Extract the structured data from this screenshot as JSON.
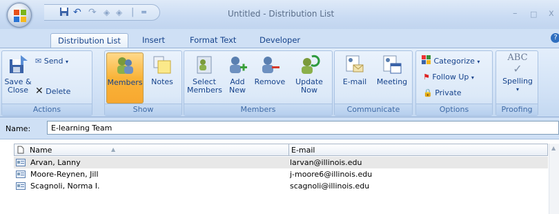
{
  "window": {
    "title": "Untitled - Distribution List",
    "minimize_glyph": "–",
    "maximize_glyph": "□",
    "close_glyph": "x"
  },
  "qat": {
    "separator": "|",
    "more_glyph": "="
  },
  "tabs": [
    {
      "label": "Distribution List",
      "active": true
    },
    {
      "label": "Insert",
      "active": false
    },
    {
      "label": "Format Text",
      "active": false
    },
    {
      "label": "Developer",
      "active": false
    }
  ],
  "ribbon": {
    "groups": {
      "actions": "Actions",
      "show": "Show",
      "members": "Members",
      "communicate": "Communicate",
      "options": "Options",
      "proofing": "Proofing"
    },
    "save_close": "Save & Close",
    "send": "Send",
    "delete": "Delete",
    "members_btn": "Members",
    "notes": "Notes",
    "select_members": "Select Members",
    "add_new": "Add New",
    "remove": "Remove",
    "update_now": "Update Now",
    "email": "E-mail",
    "meeting": "Meeting",
    "categorize": "Categorize",
    "follow_up": "Follow Up",
    "private": "Private",
    "spelling": "Spelling",
    "abc": "ABC"
  },
  "form": {
    "name_label": "Name:",
    "name_value": "E-learning Team"
  },
  "table": {
    "col_name": "Name",
    "col_email": "E-mail",
    "rows": [
      {
        "name": "Arvan, Lanny",
        "email": "larvan@illinois.edu",
        "selected": true
      },
      {
        "name": "Moore-Reynen, Jill",
        "email": "j-moore6@illinois.edu",
        "selected": false
      },
      {
        "name": "Scagnoli, Norma I.",
        "email": "scagnoli@illinois.edu",
        "selected": false
      }
    ]
  },
  "colors": {
    "accent": "#15428b",
    "pressed": "#f9b338",
    "selection": "#e8e8e8"
  }
}
